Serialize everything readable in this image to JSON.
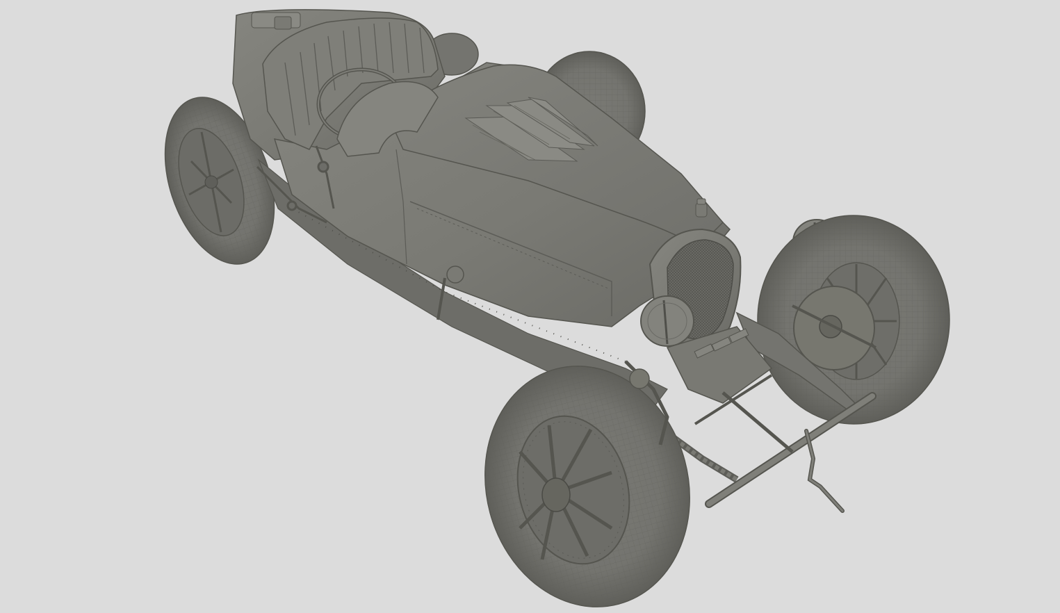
{
  "viewport": {
    "background_color": "#dcdcdc",
    "model_color": "#7b7b76",
    "model_shadow_color": "#5f5f5b",
    "model_highlight_color": "#8f8f8a",
    "line_color": "#55554f",
    "model_subject": "vintage-race-car-3d-model"
  }
}
